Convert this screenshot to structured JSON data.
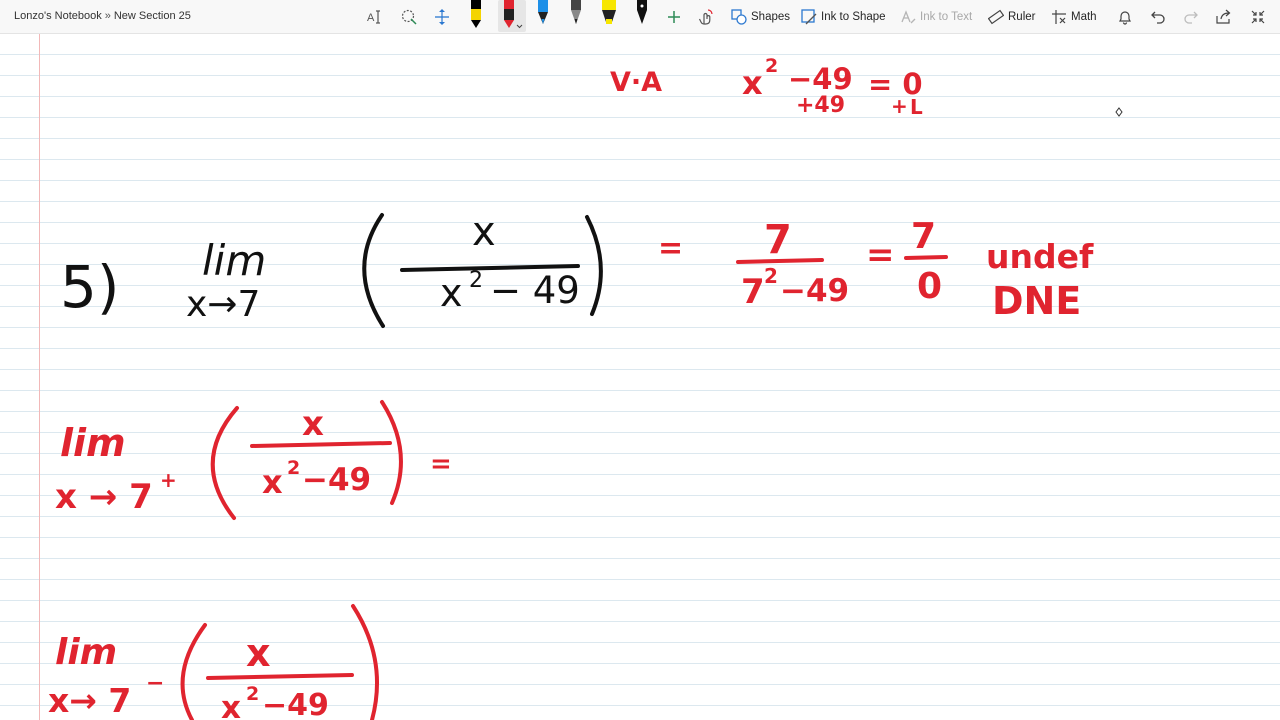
{
  "breadcrumb": {
    "notebook": "Lonzo's Notebook",
    "separator": "»",
    "section": "New Section 25"
  },
  "toolbar": {
    "shapes_label": "Shapes",
    "ink_to_shape_label": "Ink to Shape",
    "ink_to_text_label": "Ink to Text",
    "ruler_label": "Ruler",
    "math_label": "Math"
  },
  "pens": [
    {
      "color": "#000000",
      "tip": "#f4d400"
    },
    {
      "color": "#e0242f",
      "tip": "#e0242f"
    },
    {
      "color": "#1e90e8",
      "tip": "#1e90e8"
    },
    {
      "color": "#333333",
      "tip": "#333333"
    },
    {
      "color": "#f7e600",
      "tip": "#f7e600"
    },
    {
      "color": "#111111",
      "tip": "#111111"
    }
  ],
  "colors": {
    "black_ink": "#111111",
    "red_ink": "#e0242f"
  },
  "notes": {
    "va": {
      "label": "V·A",
      "x": "x",
      "exp": "2",
      "minus49": "−49",
      "eq0": "= 0",
      "plus49": "+49",
      "plus_right": "+",
      "sixteen_gly": "L"
    },
    "problem5": {
      "number": "5)",
      "lim": "lim",
      "approach": "x→7",
      "numerator": "x",
      "denominator_base": "x",
      "denominator_exp": "2",
      "denominator_rest": "− 49"
    },
    "solution5": {
      "equals1": "=",
      "num": "7",
      "den_base": "7",
      "den_exp": "2",
      "den_rest": "−49",
      "equals2": "=",
      "num2": "7",
      "den2": "0",
      "undef": "undef",
      "dne": "DNE"
    },
    "right_limit": {
      "lim": "lim",
      "approach": "x → 7",
      "approach_sup": "+",
      "numerator": "x",
      "den_base": "x",
      "den_exp": "2",
      "den_rest": "−49",
      "equals": "="
    },
    "left_limit": {
      "lim": "lim",
      "approach": "x→ 7",
      "approach_sup": "−",
      "numerator": "x",
      "den_base": "x",
      "den_exp": "2",
      "den_rest": "−49"
    }
  }
}
